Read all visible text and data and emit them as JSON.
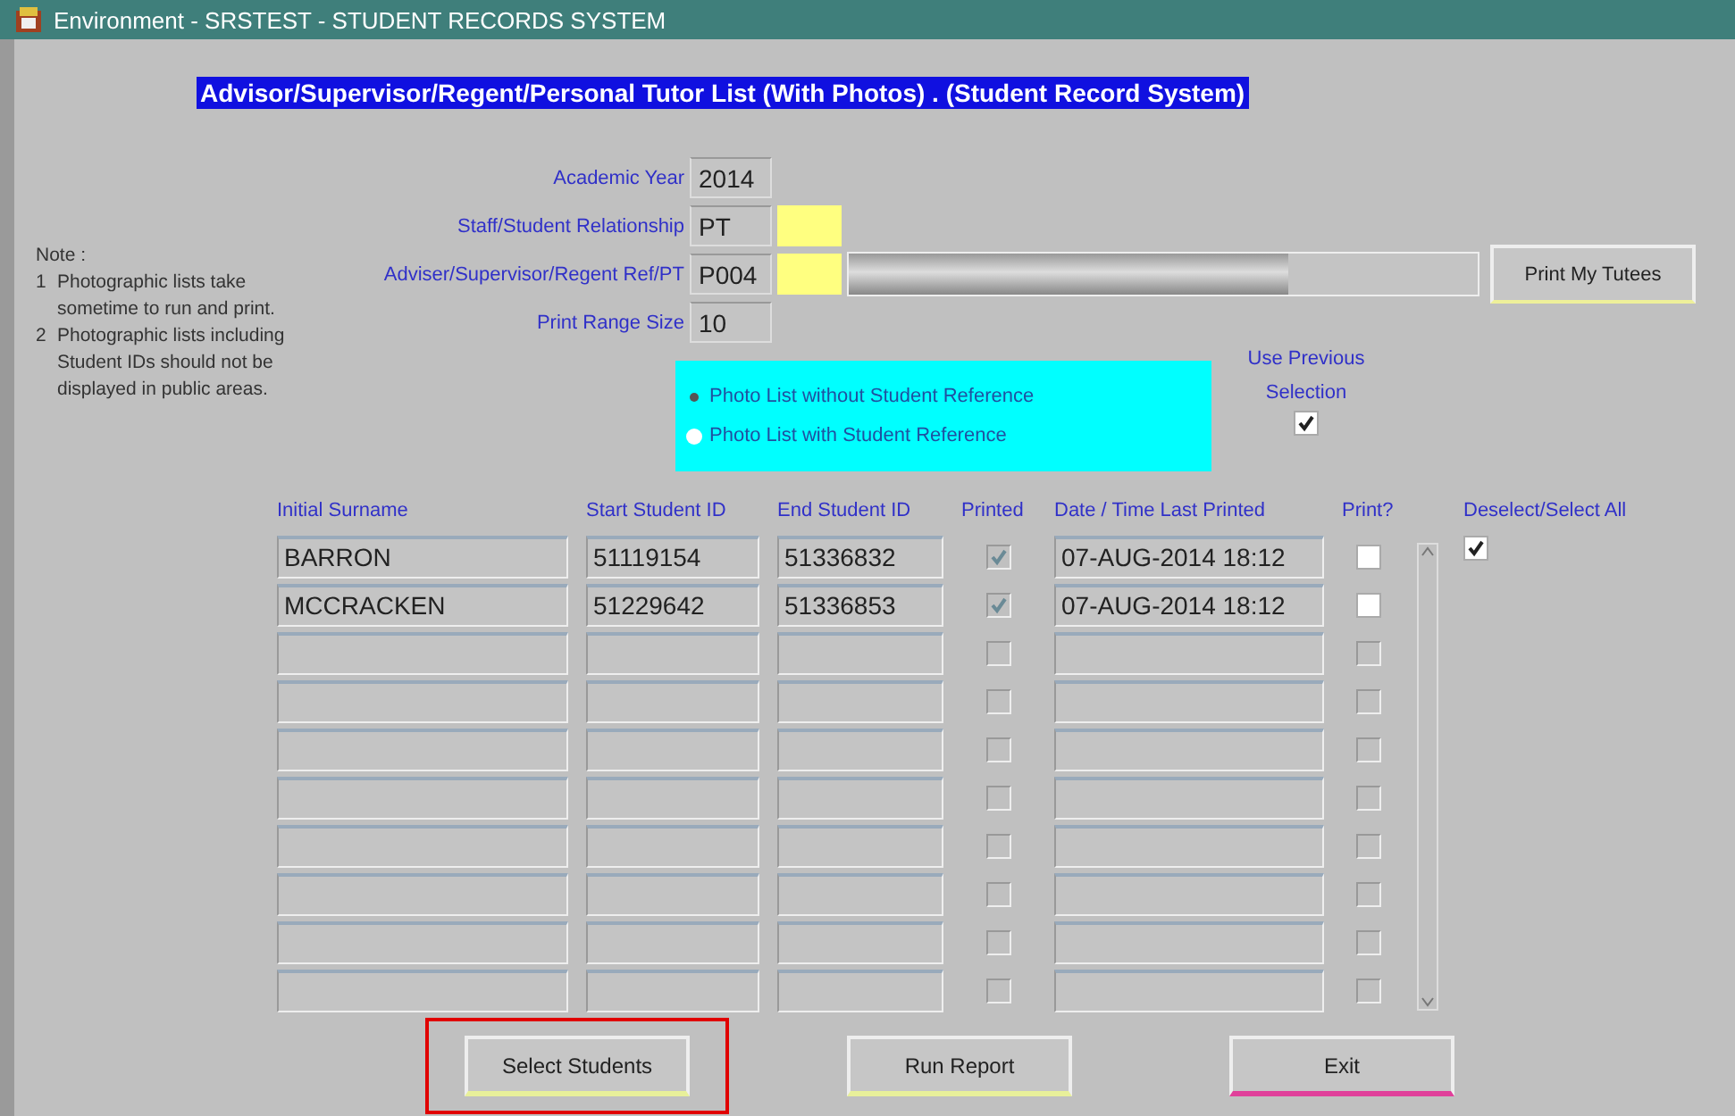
{
  "window": {
    "title": "Environment - SRSTEST - STUDENT RECORDS SYSTEM"
  },
  "heading": "Advisor/Supervisor/Regent/Personal Tutor List (With Photos) . (Student Record System)",
  "note": {
    "title": "Note :",
    "lines": [
      {
        "number": "1",
        "text": "Photographic lists take sometime to run and print."
      },
      {
        "number": "2",
        "text": "Photographic lists including Student IDs should not be displayed in public areas."
      }
    ]
  },
  "fields": [
    {
      "label": "Academic Year",
      "value": "2014",
      "extra": false,
      "progress": false
    },
    {
      "label": "Staff/Student Relationship",
      "value": "PT",
      "extra": true,
      "progress": false
    },
    {
      "label": "Adviser/Supervisor/Regent Ref/PT",
      "value": "P004",
      "extra": true,
      "progress": true
    },
    {
      "label": "Print Range Size",
      "value": "10",
      "extra": false,
      "progress": false
    }
  ],
  "progress": {
    "level": 0.7
  },
  "print_tutees_button": "Print My Tutees",
  "radios": [
    {
      "label": "Photo List without Student Reference",
      "selected": true
    },
    {
      "label": "Photo List with Student Reference",
      "selected": false
    }
  ],
  "use_previous": {
    "label": "Use Previous Selection",
    "checked": true
  },
  "table": {
    "columns": [
      "Initial Surname",
      "Start Student ID",
      "End Student ID",
      "Printed",
      "Date / Time Last Printed",
      "Print?"
    ],
    "rows": [
      {
        "surname": "BARRON",
        "start_id": "51119154",
        "end_id": "51336832",
        "printed": true,
        "date": "07-AUG-2014 18:12",
        "print": false
      },
      {
        "surname": "MCCRACKEN",
        "start_id": "51229642",
        "end_id": "51336853",
        "printed": true,
        "date": "07-AUG-2014 18:12",
        "print": false
      },
      {
        "printed": false,
        "print": false
      },
      {
        "printed": false,
        "print": false
      },
      {
        "printed": false,
        "print": false
      },
      {
        "printed": false,
        "print": false
      },
      {
        "printed": false,
        "print": false
      },
      {
        "printed": false,
        "print": false
      },
      {
        "printed": false,
        "print": false
      },
      {
        "printed": false,
        "print": false
      }
    ]
  },
  "select_all": {
    "label": "Deselect/Select All",
    "checked": true
  },
  "buttons": [
    {
      "label": "Select Students",
      "highlighted": true
    },
    {
      "label": "Run Report",
      "highlighted": false
    },
    {
      "label": "Exit",
      "highlighted": false
    }
  ]
}
